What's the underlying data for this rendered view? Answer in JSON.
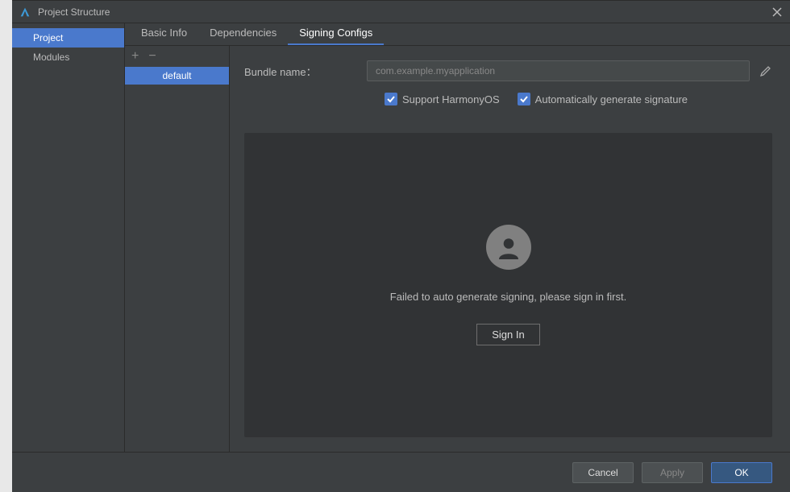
{
  "window": {
    "title": "Project Structure"
  },
  "sidebar": {
    "items": [
      {
        "label": "Project",
        "selected": true
      },
      {
        "label": "Modules",
        "selected": false
      }
    ]
  },
  "tabs": [
    {
      "label": "Basic Info",
      "active": false
    },
    {
      "label": "Dependencies",
      "active": false
    },
    {
      "label": "Signing Configs",
      "active": true
    }
  ],
  "config_list": {
    "items": [
      {
        "label": "default",
        "selected": true
      }
    ]
  },
  "form": {
    "bundle_label": "Bundle name：",
    "bundle_placeholder": "com.example.myapplication",
    "bundle_value": "",
    "support_label": "Support HarmonyOS",
    "support_checked": true,
    "auto_label": "Automatically generate signature",
    "auto_checked": true
  },
  "signin": {
    "message": "Failed to auto generate signing, please sign in first.",
    "button": "Sign In"
  },
  "footer": {
    "cancel": "Cancel",
    "apply": "Apply",
    "ok": "OK"
  }
}
